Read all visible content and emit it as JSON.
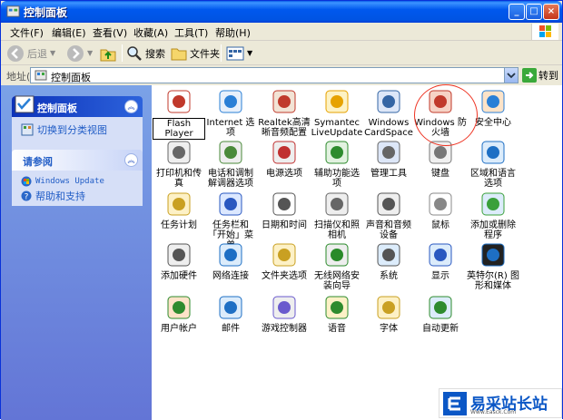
{
  "window": {
    "title": "控制面板"
  },
  "menu": [
    "文件(F)",
    "编辑(E)",
    "查看(V)",
    "收藏(A)",
    "工具(T)",
    "帮助(H)"
  ],
  "toolbar": {
    "back": "后退",
    "search": "搜索",
    "folders": "文件夹"
  },
  "address": {
    "label": "地址(D)",
    "value": "控制面板",
    "go": "转到"
  },
  "left": {
    "panel1_title": "控制面板",
    "switch_view": "切换到分类视图",
    "panel2_title": "请参阅",
    "windows_update": "Windows Update",
    "help_support": "帮助和支持"
  },
  "items": [
    {
      "label": "Flash Player",
      "icon": "flash-icon"
    },
    {
      "label": "Internet 选项",
      "icon": "internet-options-icon"
    },
    {
      "label": "Realtek高清晰音频配置",
      "icon": "audio-config-icon"
    },
    {
      "label": "Symantec LiveUpdate",
      "icon": "liveupdate-icon"
    },
    {
      "label": "Windows CardSpace",
      "icon": "cardspace-icon"
    },
    {
      "label": "Windows 防火墙",
      "icon": "firewall-icon"
    },
    {
      "label": "安全中心",
      "icon": "security-center-icon"
    },
    {
      "label": "打印机和传真",
      "icon": "printer-icon"
    },
    {
      "label": "电话和调制解调器选项",
      "icon": "phone-modem-icon"
    },
    {
      "label": "电源选项",
      "icon": "power-icon"
    },
    {
      "label": "辅助功能选项",
      "icon": "accessibility-icon"
    },
    {
      "label": "管理工具",
      "icon": "admin-tools-icon"
    },
    {
      "label": "键盘",
      "icon": "keyboard-icon"
    },
    {
      "label": "区域和语言选项",
      "icon": "globe-icon"
    },
    {
      "label": "任务计划",
      "icon": "scheduled-tasks-icon"
    },
    {
      "label": "任务栏和「开始」菜单",
      "icon": "taskbar-icon"
    },
    {
      "label": "日期和时间",
      "icon": "clock-icon"
    },
    {
      "label": "扫描仪和照相机",
      "icon": "scanner-icon"
    },
    {
      "label": "声音和音频设备",
      "icon": "speaker-icon"
    },
    {
      "label": "鼠标",
      "icon": "mouse-icon"
    },
    {
      "label": "添加或删除程序",
      "icon": "add-remove-icon"
    },
    {
      "label": "添加硬件",
      "icon": "add-hardware-icon"
    },
    {
      "label": "网络连接",
      "icon": "network-icon"
    },
    {
      "label": "文件夹选项",
      "icon": "folder-options-icon"
    },
    {
      "label": "无线网络安装向导",
      "icon": "wireless-icon"
    },
    {
      "label": "系统",
      "icon": "system-icon"
    },
    {
      "label": "显示",
      "icon": "display-icon"
    },
    {
      "label": "英特尔(R) 图形和媒体",
      "icon": "intel-graphics-icon"
    },
    {
      "label": "用户帐户",
      "icon": "users-icon"
    },
    {
      "label": "邮件",
      "icon": "mail-icon"
    },
    {
      "label": "游戏控制器",
      "icon": "gamepad-icon"
    },
    {
      "label": "语音",
      "icon": "speech-icon"
    },
    {
      "label": "字体",
      "icon": "fonts-icon"
    },
    {
      "label": "自动更新",
      "icon": "auto-update-icon"
    }
  ],
  "watermark": {
    "text": "易采站长站",
    "sub": "Www.Easck.Com"
  }
}
